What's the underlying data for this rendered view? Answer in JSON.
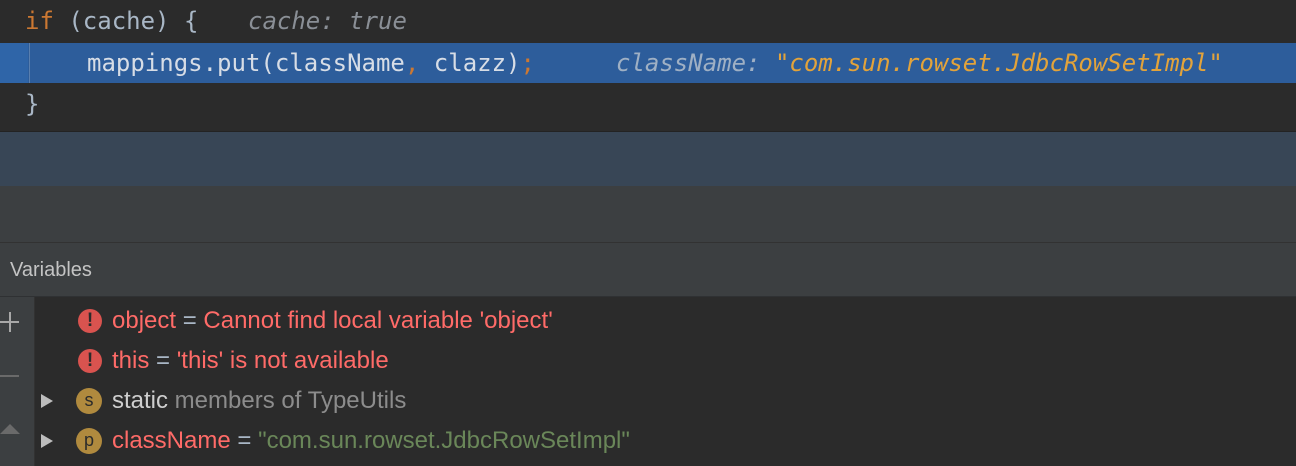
{
  "editor": {
    "line1": {
      "keyword": "if",
      "code": " (cache) {",
      "inline_name": "cache:",
      "inline_value": "true"
    },
    "line2": {
      "code_before": "mappings.put(className",
      "comma": ",",
      "code_after": " clazz)",
      "semicolon": ";",
      "inline_name": "className:",
      "inline_value": "\"com.sun.rowset.JdbcRowSetImpl\""
    },
    "line3": {
      "code": "}"
    }
  },
  "panel": {
    "title": "Variables"
  },
  "variables": [
    {
      "icon": "error-icon",
      "icon_glyph": "!",
      "name": "object",
      "eq": " = ",
      "value": "Cannot find local variable 'object'"
    },
    {
      "icon": "error-icon",
      "icon_glyph": "!",
      "name": "this",
      "eq": " = ",
      "value": "'this' is not available"
    },
    {
      "icon": "static-badge-icon",
      "icon_glyph": "s",
      "name": "static",
      "value": " members of TypeUtils"
    },
    {
      "icon": "parameter-badge-icon",
      "icon_glyph": "p",
      "name": "className",
      "eq": " = ",
      "value": "\"com.sun.rowset.JdbcRowSetImpl\""
    }
  ],
  "colors": {
    "editor_bg": "#2b2b2b",
    "execution_line": "#2d5d9b",
    "keyword": "#cc7832",
    "error_text": "#ff6b68",
    "string_value": "#6a8759",
    "inline_string": "#e3a33a"
  }
}
